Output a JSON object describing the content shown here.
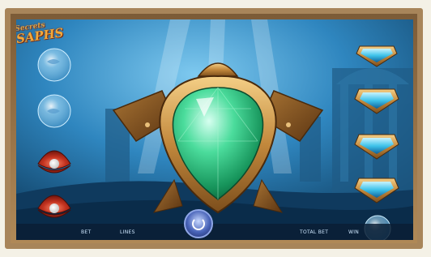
{
  "game": {
    "logo_line1": "Secrets",
    "logo_line2": "SAPHS"
  },
  "hud": {
    "bet_label": "BET",
    "lines_label": "LINES",
    "total_bet_label": "TOTAL BET",
    "win_label": "WIN"
  },
  "colors": {
    "frame": "#a8855a",
    "background_deep": "#0b3c64",
    "background_light": "#4fa6da",
    "gem_green": "#2fbf7a",
    "gem_frame_gold": "#c28a3e",
    "shell_red": "#a8261b",
    "pearl": "#f4f4f4",
    "jewel_blue": "#3ec3ea"
  },
  "icons": {
    "left_column": [
      "bubble-icon",
      "bubble-icon",
      "pearl-shell-icon",
      "pearl-shell-icon"
    ],
    "center": "emerald-turtle-gem-icon",
    "right_column": [
      "blue-jewel-icon",
      "blue-jewel-icon",
      "blue-jewel-icon",
      "blue-jewel-icon",
      "bubble-icon"
    ],
    "spin": "spin-icon"
  }
}
